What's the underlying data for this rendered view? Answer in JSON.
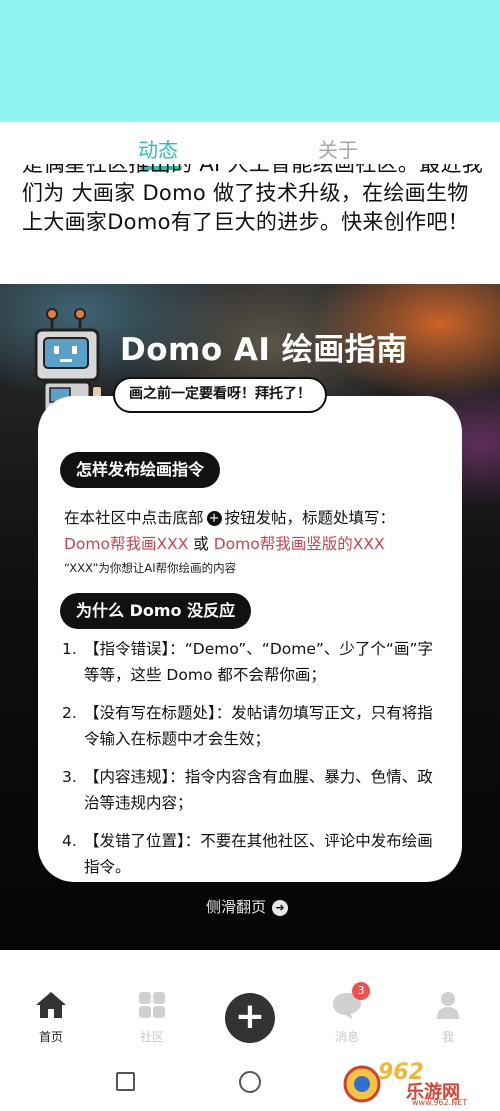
{
  "tabs": {
    "active": "动态",
    "inactive": "关于"
  },
  "intro": {
    "text": "是偶星社区推出的 AI 人工智能绘画社区。最近我们为 大画家 Domo 做了技术升级，在绘画生物上大画家Domo有了巨大的进步。快来创作吧！"
  },
  "guide": {
    "title": "Domo AI 绘画指南",
    "bubble": "画之前一定要看呀！拜托了！",
    "section1_title": "怎样发布绘画指令",
    "line1_pre": "在本社区中点击底部",
    "line1_post": "按钮发帖，标题处填写：",
    "cmd1": "Domo帮我画XXX",
    "or": " 或 ",
    "cmd2": "Domo帮我画竖版的XXX",
    "note": "“XXX”为你想让AI帮你绘画的内容",
    "section2_title": "为什么 Domo 没反应",
    "items": [
      {
        "num": "1.",
        "text": "【指令错误】：“Demo”、“Dome”、少了个“画”字等等，这些 Domo 都不会帮你画；"
      },
      {
        "num": "2.",
        "text": "【没有写在标题处】：发帖请勿填写正文，只有将指令输入在标题中才会生效；"
      },
      {
        "num": "3.",
        "text": "【内容违规】：指令内容含有血腥、暴力、色情、政治等违规内容；"
      },
      {
        "num": "4.",
        "text": "【发错了位置】：不要在其他社区、评论中发布绘画指令。"
      }
    ],
    "swipe": "侧滑翻页"
  },
  "bottom_nav": {
    "home": "首页",
    "community": "社区",
    "messages": "消息",
    "messages_badge": "3",
    "me": "我"
  },
  "watermark": {
    "num": "962",
    "text": "乐游网",
    "url": "www.962.NET"
  }
}
